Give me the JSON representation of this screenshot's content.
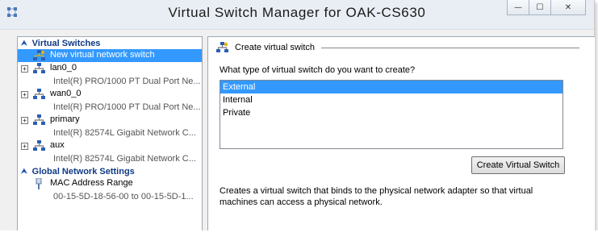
{
  "window": {
    "title": "Virtual Switch Manager for OAK-CS630",
    "buttons": {
      "minimize": "—",
      "maximize": "☐",
      "close": "✕"
    }
  },
  "left_pane": {
    "virtual_switches_header": "Virtual Switches",
    "items": [
      {
        "label": "New virtual network switch"
      },
      {
        "label": "lan0_0",
        "sub": "Intel(R) PRO/1000 PT Dual Port Ne..."
      },
      {
        "label": "wan0_0",
        "sub": "Intel(R) PRO/1000 PT Dual Port Ne..."
      },
      {
        "label": "primary",
        "sub": "Intel(R) 82574L Gigabit Network C..."
      },
      {
        "label": "aux",
        "sub": "Intel(R) 82574L Gigabit Network C..."
      }
    ],
    "global_header": "Global Network Settings",
    "mac": {
      "label": "MAC Address Range",
      "sub": "00-15-5D-18-56-00 to 00-15-5D-1..."
    }
  },
  "right_pane": {
    "heading": "Create virtual switch",
    "question": "What type of virtual switch do you want to create?",
    "options": [
      "External",
      "Internal",
      "Private"
    ],
    "selected_option": "External",
    "create_button": "Create Virtual Switch",
    "description": "Creates a virtual switch that binds to the physical network adapter so that virtual machines can access a physical network."
  },
  "colors": {
    "selection": "#3399ff",
    "section_header": "#0f3a86"
  }
}
